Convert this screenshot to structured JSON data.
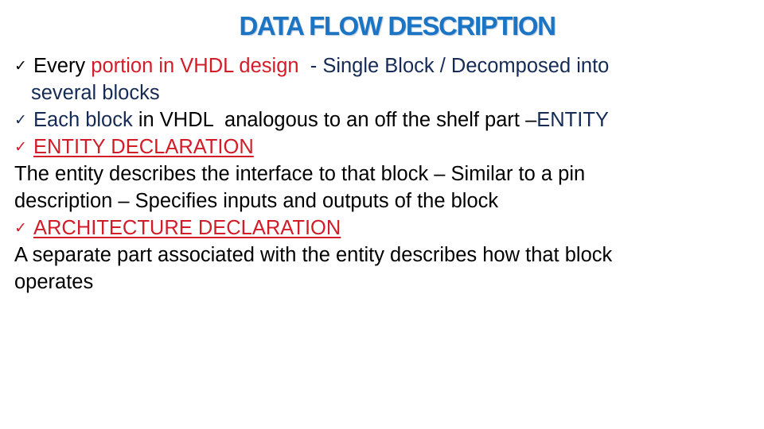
{
  "slide": {
    "title": "DATA FLOW DESCRIPTION",
    "colors": {
      "title": "#1b75c4",
      "navy": "#152b56",
      "red": "#d21d28",
      "black": "#000000"
    },
    "bullet_icon": "checkmark-icon",
    "bullet_glyph": "✓",
    "items": [
      {
        "type": "bullet",
        "parts": [
          "Every ",
          "portion in VHDL design",
          "  - Single Block / Decomposed into"
        ],
        "continuation": "several blocks"
      },
      {
        "type": "bullet",
        "parts": [
          "Each block",
          " in VHDL  analogous to an off the shelf part –",
          "ENTITY"
        ]
      },
      {
        "type": "heading",
        "text": "ENTITY DECLARATION"
      },
      {
        "type": "paragraph",
        "lines": [
          "The entity describes the interface to that block – Similar to a pin",
          "description – Specifies inputs and outputs of the block"
        ]
      },
      {
        "type": "heading",
        "text": "ARCHITECTURE DECLARATION"
      },
      {
        "type": "paragraph",
        "lines": [
          "A separate part associated with the entity describes how that block",
          "operates"
        ]
      }
    ]
  }
}
